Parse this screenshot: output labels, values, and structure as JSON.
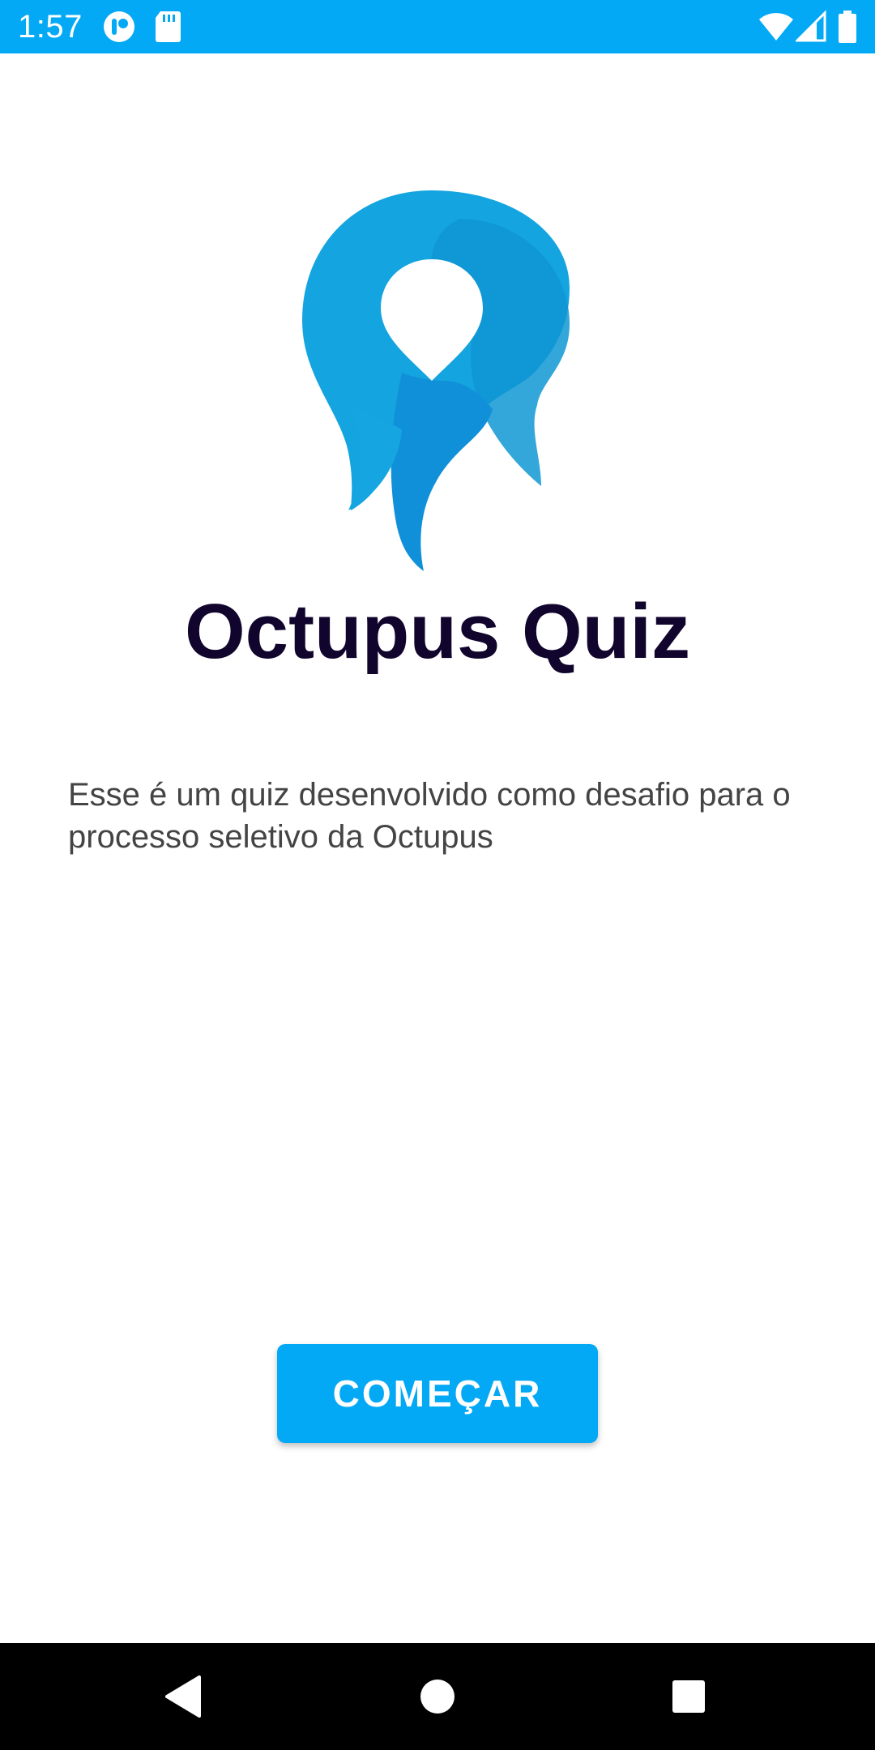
{
  "status_bar": {
    "time": "1:57",
    "background_color": "#03a9f4",
    "icons": [
      "notification-app-icon",
      "sd-card-icon",
      "wifi-icon",
      "cell-signal-icon",
      "battery-icon"
    ]
  },
  "app": {
    "title": "Octupus Quiz",
    "description": "Esse é um quiz desenvolvido como desafio para o processo seletivo da Octupus",
    "start_button_label": "COMEÇAR",
    "accent_color": "#03a9f4",
    "title_color": "#12052d"
  },
  "nav_bar": {
    "buttons": [
      "back-icon",
      "home-icon",
      "recents-icon"
    ]
  }
}
